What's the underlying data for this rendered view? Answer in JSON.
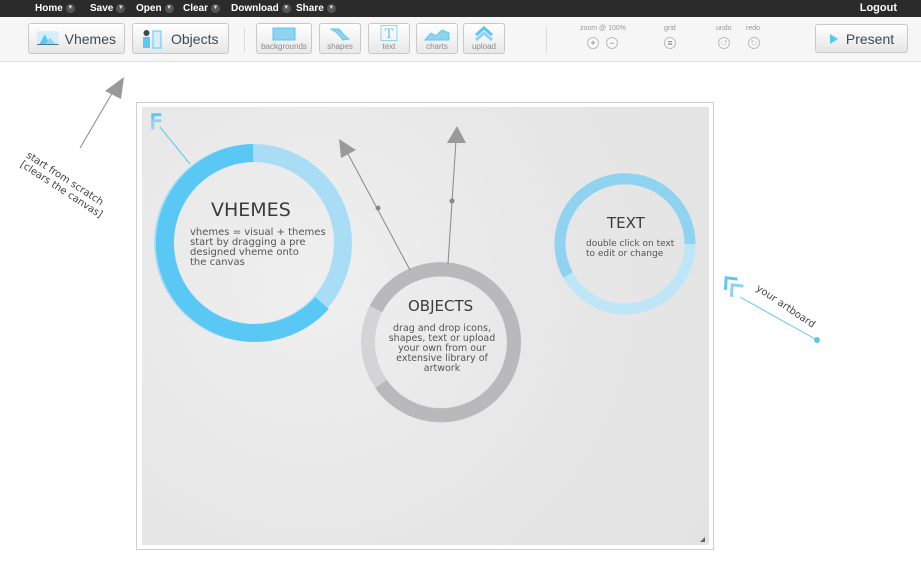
{
  "menu": {
    "items": [
      {
        "label": "Home"
      },
      {
        "label": "Save"
      },
      {
        "label": "Open"
      },
      {
        "label": "Clear"
      },
      {
        "label": "Download"
      },
      {
        "label": "Share"
      }
    ],
    "logout": "Logout"
  },
  "toolbar": {
    "vhemes_label": "Vhemes",
    "objects_label": "Objects",
    "tools": [
      {
        "label": "backgrounds",
        "icon": "backgrounds-icon"
      },
      {
        "label": "shapes",
        "icon": "shapes-icon"
      },
      {
        "label": "text",
        "icon": "text-icon"
      },
      {
        "label": "charts",
        "icon": "charts-icon"
      },
      {
        "label": "upload",
        "icon": "upload-icon"
      }
    ],
    "zoom_label": "zoom @ 100%",
    "grid_label": "grid",
    "undo_label": "undo",
    "redo_label": "redo",
    "present_label": "Present"
  },
  "canvas": {
    "vhemes": {
      "title": "VHEMES",
      "desc_lines": [
        "vhemes = visual + themes",
        "start by dragging a pre",
        "designed vheme onto",
        "the canvas"
      ]
    },
    "objects": {
      "title": "OBJECTS",
      "desc_lines": [
        "drag and drop icons,",
        "shapes, text or upload",
        "your own from our",
        "extensive library of",
        "artwork"
      ]
    },
    "text": {
      "title": "TEXT",
      "desc_lines": [
        "double click on text",
        "to edit or change"
      ]
    }
  },
  "annotations": {
    "start_scratch": "start from scratch",
    "clears_canvas": "[clears the canvas]",
    "your_artboard": "your artboard"
  },
  "colors": {
    "accent": "#5ac8f5",
    "accent_light": "#a9ddf6",
    "text_ring": "#8fd3f0",
    "text_ring_light": "#bfe6f7",
    "objects_ring": "#b9b9bb",
    "objects_ring_light": "#d4d4d6",
    "menubar": "#2b2b2b"
  }
}
